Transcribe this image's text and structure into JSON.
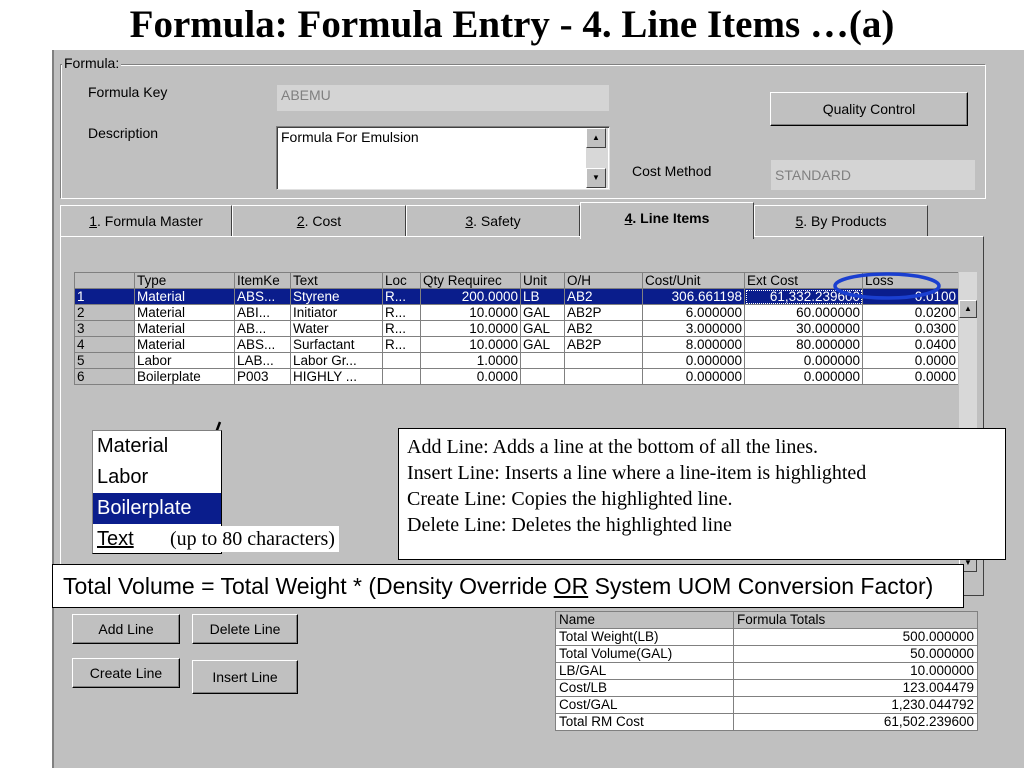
{
  "slide_title": "Formula: Formula Entry - 4. Line Items …(a)",
  "formula_group": {
    "legend": "Formula:",
    "key_label": "Formula Key",
    "key_value": "ABEMU",
    "description_label": "Description",
    "description_value": "Formula For Emulsion",
    "cost_method_label": "Cost Method",
    "cost_method_value": "STANDARD",
    "quality_control_label": "Quality Control"
  },
  "tabs": [
    {
      "num": "1",
      "label": ". Formula Master",
      "active": false
    },
    {
      "num": "2",
      "label": ". Cost",
      "active": false
    },
    {
      "num": "3",
      "label": ". Safety",
      "active": false
    },
    {
      "num": "4",
      "label": ". Line Items",
      "active": true
    },
    {
      "num": "5",
      "label": ". By Products",
      "active": false
    }
  ],
  "grid": {
    "columns": [
      "Type",
      "ItemKe",
      "Text",
      "Loc",
      "Qty Requirec",
      "Unit",
      "O/H",
      "Cost/Unit",
      "Ext Cost",
      "Loss"
    ],
    "rows": [
      {
        "no": "1",
        "type": "Material",
        "item": "ABS...",
        "text": "Styrene",
        "loc": "R...",
        "qty": "200.0000",
        "unit": "LB",
        "oh": "AB2",
        "cost_unit": "306.661198",
        "ext_cost": "61,332.239600",
        "loss": "0.0100",
        "selected": true
      },
      {
        "no": "2",
        "type": "Material",
        "item": "ABI...",
        "text": "Initiator",
        "loc": "R...",
        "qty": "10.0000",
        "unit": "GAL",
        "oh": "AB2P",
        "cost_unit": "6.000000",
        "ext_cost": "60.000000",
        "loss": "0.0200",
        "selected": false
      },
      {
        "no": "3",
        "type": "Material",
        "item": "AB...",
        "text": "Water",
        "loc": "R...",
        "qty": "10.0000",
        "unit": "GAL",
        "oh": "AB2",
        "cost_unit": "3.000000",
        "ext_cost": "30.000000",
        "loss": "0.0300",
        "selected": false
      },
      {
        "no": "4",
        "type": "Material",
        "item": "ABS...",
        "text": "Surfactant",
        "loc": "R...",
        "qty": "10.0000",
        "unit": "GAL",
        "oh": "AB2P",
        "cost_unit": "8.000000",
        "ext_cost": "80.000000",
        "loss": "0.0400",
        "selected": false
      },
      {
        "no": "5",
        "type": "Labor",
        "item": "LAB...",
        "text": "Labor Gr...",
        "loc": "",
        "qty": "1.0000",
        "unit": "",
        "oh": "",
        "cost_unit": "0.000000",
        "ext_cost": "0.000000",
        "loss": "0.0000",
        "selected": false
      },
      {
        "no": "6",
        "type": "Boilerplate",
        "item": "P003",
        "text": "HIGHLY ...",
        "loc": "",
        "qty": "0.0000",
        "unit": "",
        "oh": "",
        "cost_unit": "0.000000",
        "ext_cost": "0.000000",
        "loss": "0.0000",
        "selected": false
      }
    ]
  },
  "type_dropdown": {
    "items": [
      "Material",
      "Labor",
      "Boilerplate",
      "Text"
    ],
    "selected": "Boilerplate",
    "note": "(up to 80 characters)"
  },
  "info_callout": {
    "lines": [
      "Add Line: Adds a line at the bottom of all the lines.",
      "Insert Line: Inserts a line where a line-item is highlighted",
      "Create Line: Copies the highlighted line.",
      "Delete Line: Deletes the highlighted line"
    ]
  },
  "volume_callout": {
    "before": "Total Volume = Total Weight * (Density Override ",
    "or": "OR",
    "after": " System UOM Conversion Factor)"
  },
  "buttons": {
    "add_line": "Add Line",
    "delete_line": "Delete Line",
    "create_line": "Create Line",
    "insert_line": "Insert Line"
  },
  "totals": {
    "headers": [
      "Name",
      "Formula Totals"
    ],
    "rows": [
      {
        "name": "Total Weight(LB)",
        "value": "500.000000"
      },
      {
        "name": "Total Volume(GAL)",
        "value": "50.000000"
      },
      {
        "name": "LB/GAL",
        "value": "10.000000"
      },
      {
        "name": "Cost/LB",
        "value": "123.004479"
      },
      {
        "name": "Cost/GAL",
        "value": "1,230.044792"
      },
      {
        "name": "Total RM Cost",
        "value": "61,502.239600"
      }
    ]
  },
  "colors": {
    "window_bg": "#c0c0c0",
    "selection": "#0a1d8c",
    "highlight_ellipse": "#1a3fd0"
  },
  "icons": [
    "scroll-up-arrow-icon",
    "scroll-down-arrow-icon",
    "callout-pointer-icon"
  ]
}
